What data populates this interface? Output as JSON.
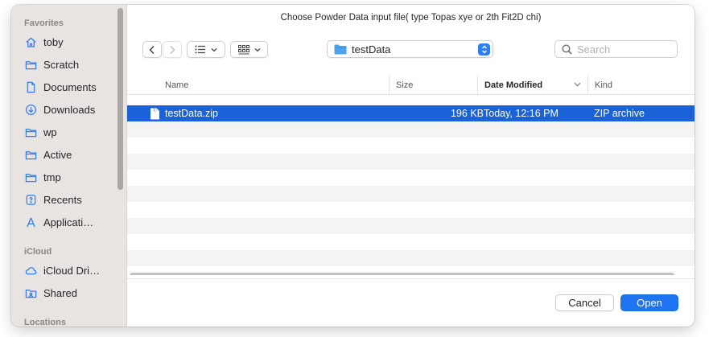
{
  "dialog": {
    "title": "Choose Powder Data input file( type Topas xye or 2th Fit2D chi)"
  },
  "sidebar": {
    "sections": {
      "favorites": "Favorites",
      "icloud": "iCloud",
      "locations": "Locations"
    },
    "items": [
      {
        "label": "toby",
        "icon": "home-icon"
      },
      {
        "label": "Scratch",
        "icon": "folder-icon"
      },
      {
        "label": "Documents",
        "icon": "document-icon"
      },
      {
        "label": "Downloads",
        "icon": "download-icon"
      },
      {
        "label": "wp",
        "icon": "folder-icon"
      },
      {
        "label": "Active",
        "icon": "folder-icon"
      },
      {
        "label": "tmp",
        "icon": "folder-icon"
      },
      {
        "label": "Recents",
        "icon": "recents-icon"
      },
      {
        "label": "Applicati…",
        "icon": "applications-icon"
      },
      {
        "label": "iCloud Dri…",
        "icon": "cloud-icon"
      },
      {
        "label": "Shared",
        "icon": "shared-folder-icon"
      }
    ]
  },
  "toolbar": {
    "back_icon": "chevron-left-icon",
    "forward_icon": "chevron-right-icon",
    "list_view_icon": "list-view-icon",
    "grid_view_icon": "grid-view-icon",
    "location": "testData",
    "search_placeholder": "Search"
  },
  "table": {
    "columns": {
      "name": "Name",
      "size": "Size",
      "date": "Date Modified",
      "kind": "Kind"
    },
    "sorted_column": "Date Modified",
    "rows": [
      {
        "name": "testData.zip",
        "size": "196 KB",
        "date": "Today, 12:16 PM",
        "kind": "ZIP archive",
        "selected": true
      }
    ]
  },
  "buttons": {
    "cancel": "Cancel",
    "open": "Open"
  },
  "colors": {
    "accent": "#1f74f2",
    "selection": "#1a62d7",
    "sidebar_bg": "#e8e4e1"
  }
}
